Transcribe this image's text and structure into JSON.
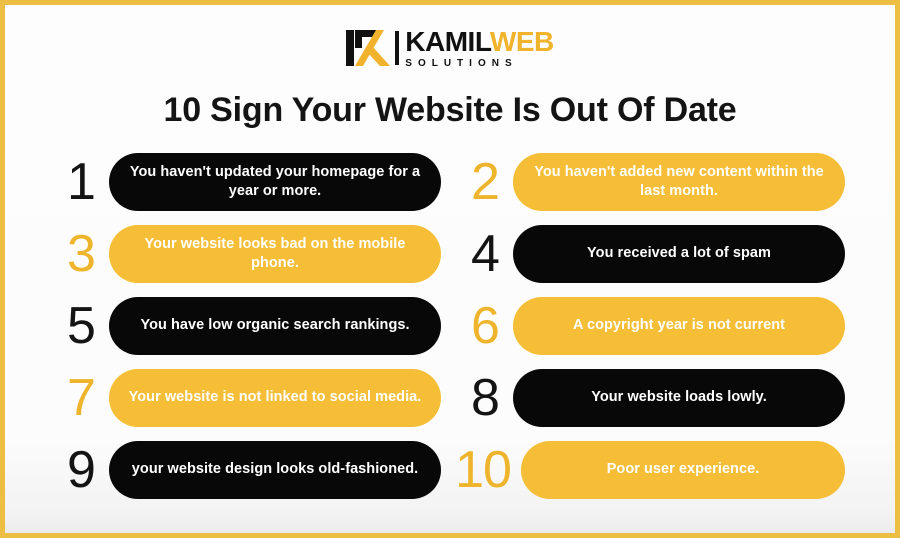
{
  "brand": {
    "logo_mark": "kamil-k-monogram",
    "name_part1": "KAMIL",
    "name_part2": "WEB",
    "tagline": "SOLUTIONS",
    "dark_color": "#111111",
    "accent_color": "#F0B32B"
  },
  "heading": "10 Sign Your Website Is Out Of Date",
  "theme": {
    "border_color": "#EDBE44",
    "gold": "#F5BE36",
    "black": "#080808",
    "background": "#fbfbfb"
  },
  "items": [
    {
      "number": "1",
      "text": "You haven't updated your homepage for a year or more.",
      "style": "dark",
      "number_style": "dark"
    },
    {
      "number": "2",
      "text": "You haven't added new content within the last month.",
      "style": "gold",
      "number_style": "gold"
    },
    {
      "number": "3",
      "text": "Your website looks bad on the mobile phone.",
      "style": "gold",
      "number_style": "gold"
    },
    {
      "number": "4",
      "text": "You received a lot of spam",
      "style": "dark",
      "number_style": "dark"
    },
    {
      "number": "5",
      "text": "You have low organic search rankings.",
      "style": "dark",
      "number_style": "dark"
    },
    {
      "number": "6",
      "text": "A copyright year is not current",
      "style": "gold",
      "number_style": "gold"
    },
    {
      "number": "7",
      "text": "Your website is not linked to social media.",
      "style": "gold",
      "number_style": "gold"
    },
    {
      "number": "8",
      "text": "Your website loads lowly.",
      "style": "dark",
      "number_style": "dark"
    },
    {
      "number": "9",
      "text": "your website design looks old-fashioned.",
      "style": "dark",
      "number_style": "dark"
    },
    {
      "number": "10",
      "text": "Poor user experience.",
      "style": "gold",
      "number_style": "gold"
    }
  ]
}
